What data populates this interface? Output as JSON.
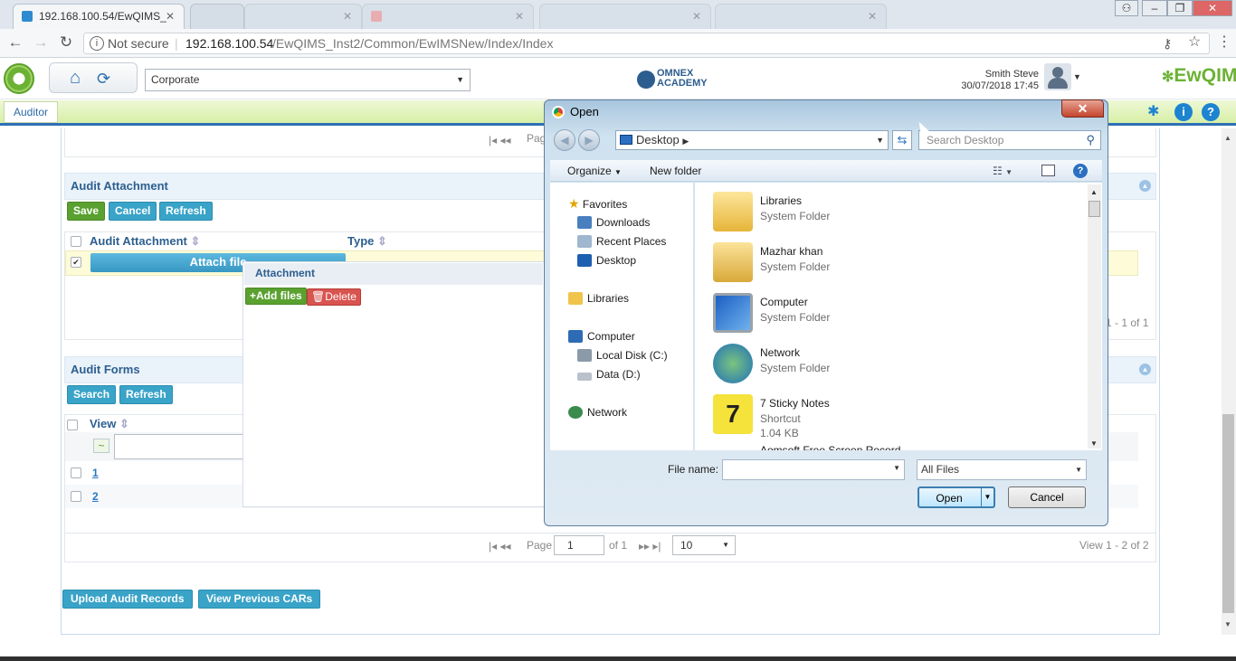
{
  "browser": {
    "active_tab_title": "192.168.100.54/EwQIMS_",
    "background_tabs": [
      "",
      "",
      "",
      "",
      "",
      ""
    ],
    "url_security": "Not secure",
    "url_host": "192.168.100.54",
    "url_path": "/EwQIMS_Inst2/Common/EwIMSNew/Index/Index",
    "window_buttons": [
      "–",
      "❐",
      "✕"
    ]
  },
  "app": {
    "org_select": "Corporate",
    "brand": "OMNEX ACADEMY",
    "product": "EwQIMS",
    "product_sup": "IMS",
    "user_name": "Smith Steve",
    "datetime": "30/07/2018 17:45",
    "role_tab": "Auditor",
    "colors": {
      "accent": "#2f6fb7",
      "green": "#5aa130",
      "teal": "#3aa3c8"
    }
  },
  "audit_attachment": {
    "title": "Audit Attachment",
    "save": "Save",
    "cancel": "Cancel",
    "refresh": "Refresh",
    "col_attachment": "Audit Attachment",
    "col_type": "Type",
    "attach_btn": "Attach file",
    "pager_label": "Page",
    "view_count": "1 - 1 of 1"
  },
  "attachment_popup": {
    "title": "Attachment",
    "add_files": "Add files",
    "delete": "Delete"
  },
  "audit_forms": {
    "title": "Audit Forms",
    "search": "Search",
    "refresh": "Refresh",
    "col_view": "View",
    "filter_op": "~",
    "rows": [
      "1",
      "2"
    ],
    "pager_label": "Page",
    "page": "1",
    "of": "of 1",
    "per_page": "10",
    "view_count": "View 1 - 2 of 2"
  },
  "footer_buttons": {
    "upload": "Upload Audit Records",
    "previous_cars": "View Previous CARs"
  },
  "dialog": {
    "title": "Open",
    "close": "✕",
    "location": "Desktop",
    "search_placeholder": "Search Desktop",
    "organize": "Organize",
    "new_folder": "New folder",
    "nav": {
      "favorites": "Favorites",
      "downloads": "Downloads",
      "recent": "Recent Places",
      "desktop": "Desktop",
      "libraries": "Libraries",
      "computer": "Computer",
      "local_disk": "Local Disk (C:)",
      "data_disk": "Data (D:)",
      "network": "Network"
    },
    "files": [
      {
        "name": "Libraries",
        "sub": "System Folder",
        "size": "",
        "icon": "libraries-folder-icon"
      },
      {
        "name": "Mazhar khan",
        "sub": "System Folder",
        "size": "",
        "icon": "user-folder-icon"
      },
      {
        "name": "Computer",
        "sub": "System Folder",
        "size": "",
        "icon": "computer-icon"
      },
      {
        "name": "Network",
        "sub": "System Folder",
        "size": "",
        "icon": "network-icon"
      },
      {
        "name": "7 Sticky Notes",
        "sub": "Shortcut",
        "size": "1.04 KB",
        "icon": "sticky-notes-icon"
      }
    ],
    "partial_item": "Aomsoft Free Screen Record",
    "file_name_label": "File name:",
    "file_name_value": "",
    "filter_value": "All Files",
    "open": "Open",
    "cancel": "Cancel"
  }
}
